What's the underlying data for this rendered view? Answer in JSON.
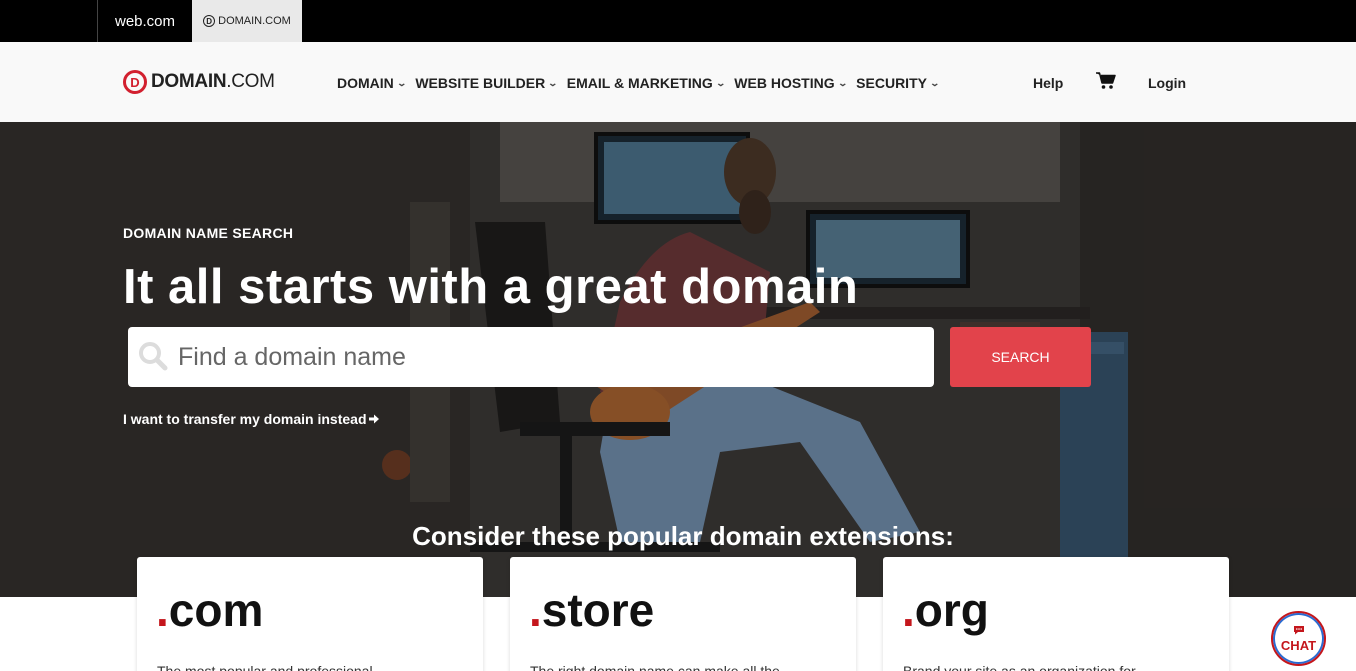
{
  "brand_bar": {
    "tabs": [
      {
        "label": "web.com"
      },
      {
        "label": "DOMAIN.COM"
      }
    ]
  },
  "header": {
    "logo": {
      "bold": "DOMAIN",
      "light": ".COM"
    },
    "nav": [
      {
        "label": "DOMAIN"
      },
      {
        "label": "WEBSITE BUILDER"
      },
      {
        "label": "EMAIL & MARKETING"
      },
      {
        "label": "WEB HOSTING"
      },
      {
        "label": "SECURITY"
      }
    ],
    "help_label": "Help",
    "login_label": "Login",
    "cart_icon": "shopping-cart-icon"
  },
  "hero": {
    "eyebrow": "DOMAIN NAME SEARCH",
    "title": "It all starts with a great domain",
    "search_placeholder": "Find a domain name",
    "search_value": "",
    "search_button": "SEARCH",
    "transfer_link": "I want to transfer my domain instead",
    "extensions_heading": "Consider these popular domain extensions:"
  },
  "extensions": [
    {
      "ext": "com",
      "desc": "The most popular and professional"
    },
    {
      "ext": "store",
      "desc": "The right domain name can make all the"
    },
    {
      "ext": "org",
      "desc": "Brand your site as an organization for"
    }
  ],
  "chat": {
    "label": "CHAT"
  },
  "colors": {
    "accent_red": "#e2434b",
    "logo_red": "#d2202f",
    "dot_red": "#c4161c"
  }
}
